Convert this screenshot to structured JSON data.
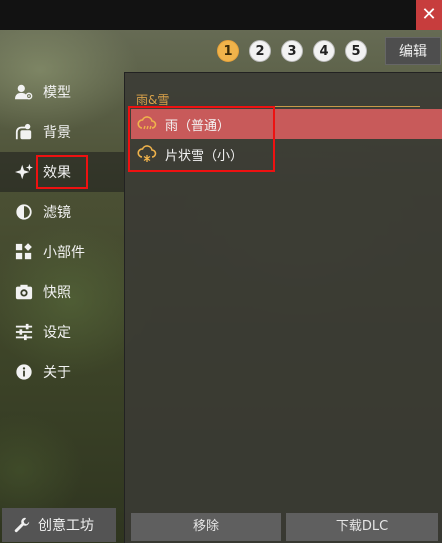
{
  "window": {
    "close_label": "✕"
  },
  "pages": [
    "1",
    "2",
    "3",
    "4",
    "5"
  ],
  "active_page": "1",
  "edit_label": "编辑",
  "sidebar": {
    "items": [
      {
        "label": "模型",
        "icon": "user-settings-icon"
      },
      {
        "label": "背景",
        "icon": "image-icon"
      },
      {
        "label": "效果",
        "icon": "sparkle-icon"
      },
      {
        "label": "滤镜",
        "icon": "contrast-icon"
      },
      {
        "label": "小部件",
        "icon": "widgets-icon"
      },
      {
        "label": "快照",
        "icon": "camera-icon"
      },
      {
        "label": "设定",
        "icon": "sliders-icon"
      },
      {
        "label": "关于",
        "icon": "info-icon"
      }
    ],
    "active": "效果",
    "workshop_label": "创意工坊"
  },
  "panel": {
    "group_title": "雨&雪",
    "items": [
      {
        "label": "雨（普通）",
        "icon": "rain-cloud-icon",
        "selected": true
      },
      {
        "label": "片状雪（小）",
        "icon": "snow-cloud-icon",
        "selected": false
      }
    ],
    "remove_label": "移除",
    "download_label": "下载DLC"
  },
  "colors": {
    "accent_orange": "#f0b34b",
    "selected_row": "#c85a5a",
    "close_red": "#c73d3d",
    "highlight_red": "#ee1111"
  }
}
